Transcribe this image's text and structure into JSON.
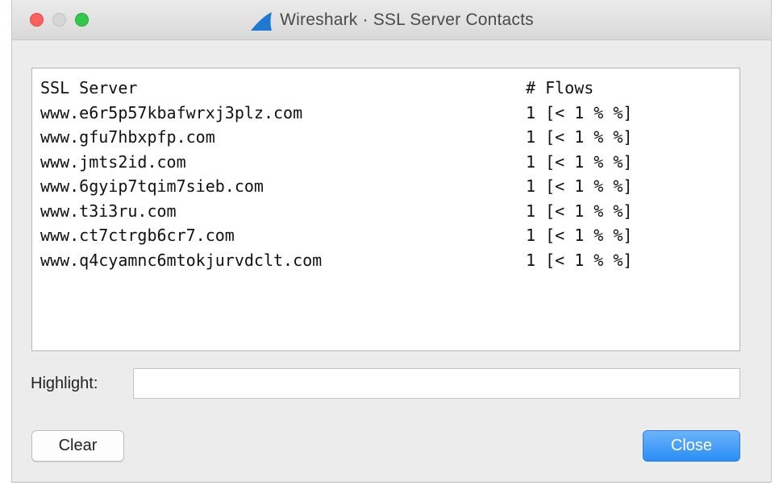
{
  "window": {
    "title": "Wireshark · SSL Server Contacts"
  },
  "table": {
    "header": {
      "server": "SSL Server",
      "flows": "# Flows"
    },
    "rows": [
      {
        "server": "www.e6r5p57kbafwrxj3plz.com",
        "flows": "1 [< 1 % %]"
      },
      {
        "server": "www.gfu7hbxpfp.com",
        "flows": "1 [< 1 % %]"
      },
      {
        "server": "www.jmts2id.com",
        "flows": "1 [< 1 % %]"
      },
      {
        "server": "www.6gyip7tqim7sieb.com",
        "flows": "1 [< 1 % %]"
      },
      {
        "server": "www.t3i3ru.com",
        "flows": "1 [< 1 % %]"
      },
      {
        "server": "www.ct7ctrgb6cr7.com",
        "flows": "1 [< 1 % %]"
      },
      {
        "server": "www.q4cyamnc6mtokjurvdclt.com",
        "flows": "1 [< 1 % %]"
      }
    ]
  },
  "highlight": {
    "label": "Highlight:",
    "value": ""
  },
  "buttons": {
    "clear": "Clear",
    "close": "Close"
  },
  "colors": {
    "close_button": "#2a8ef6",
    "traffic_close": "#fc615d",
    "traffic_zoom": "#34c84a",
    "app_icon": "#1f78d1"
  },
  "icons": {
    "app": "wireshark-fin-icon"
  }
}
